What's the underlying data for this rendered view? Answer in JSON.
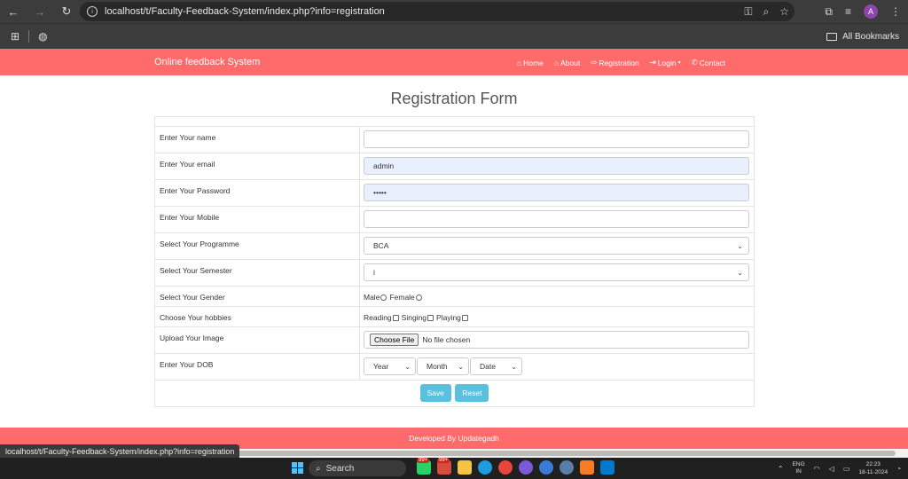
{
  "browser": {
    "url": "localhost/t/Faculty-Feedback-System/index.php?info=registration",
    "profile_initial": "A",
    "all_bookmarks": "All Bookmarks"
  },
  "site": {
    "brand": "Online feedback System",
    "nav": [
      {
        "label": "Home",
        "icon": "home-icon"
      },
      {
        "label": "About",
        "icon": "home-icon"
      },
      {
        "label": "Registration",
        "icon": "signin-icon"
      },
      {
        "label": "Login",
        "icon": "login-icon"
      },
      {
        "label": "Contact",
        "icon": "phone-icon"
      }
    ],
    "footer": "Developed By Updategadh"
  },
  "form": {
    "title": "Registration Form",
    "name_label": "Enter Your name",
    "name_value": "",
    "email_label": "Enter Your email",
    "email_value": "admin",
    "password_label": "Enter Your Password",
    "password_value": "•••••",
    "mobile_label": "Enter Your Mobile",
    "mobile_value": "",
    "programme_label": "Select Your Programme",
    "programme_value": "BCA",
    "semester_label": "Select Your Semester",
    "semester_value": "i",
    "gender_label": "Select Your Gender",
    "gender_male": "Male",
    "gender_female": "Female",
    "hobbies_label": "Choose Your hobbies",
    "hobby_reading": "Reading",
    "hobby_singing": "Singing",
    "hobby_playing": "Playing",
    "image_label": "Upload Your Image",
    "file_button": "Choose File",
    "file_status": "No file chosen",
    "dob_label": "Enter Your DOB",
    "dob_year": "Year",
    "dob_month": "Month",
    "dob_date": "Date",
    "save": "Save",
    "reset": "Reset"
  },
  "status_bar": {
    "url": "localhost/t/Faculty-Feedback-System/index.php?info=registration"
  },
  "taskbar": {
    "search": "Search",
    "badge1": "99+",
    "badge2": "99+",
    "lang_top": "ENG",
    "lang_bottom": "IN",
    "time": "22:23",
    "date": "18-11-2024"
  },
  "colors": {
    "navbar": "#ff6a6a",
    "button": "#5bc0de",
    "autofill": "#e8f0fe"
  }
}
